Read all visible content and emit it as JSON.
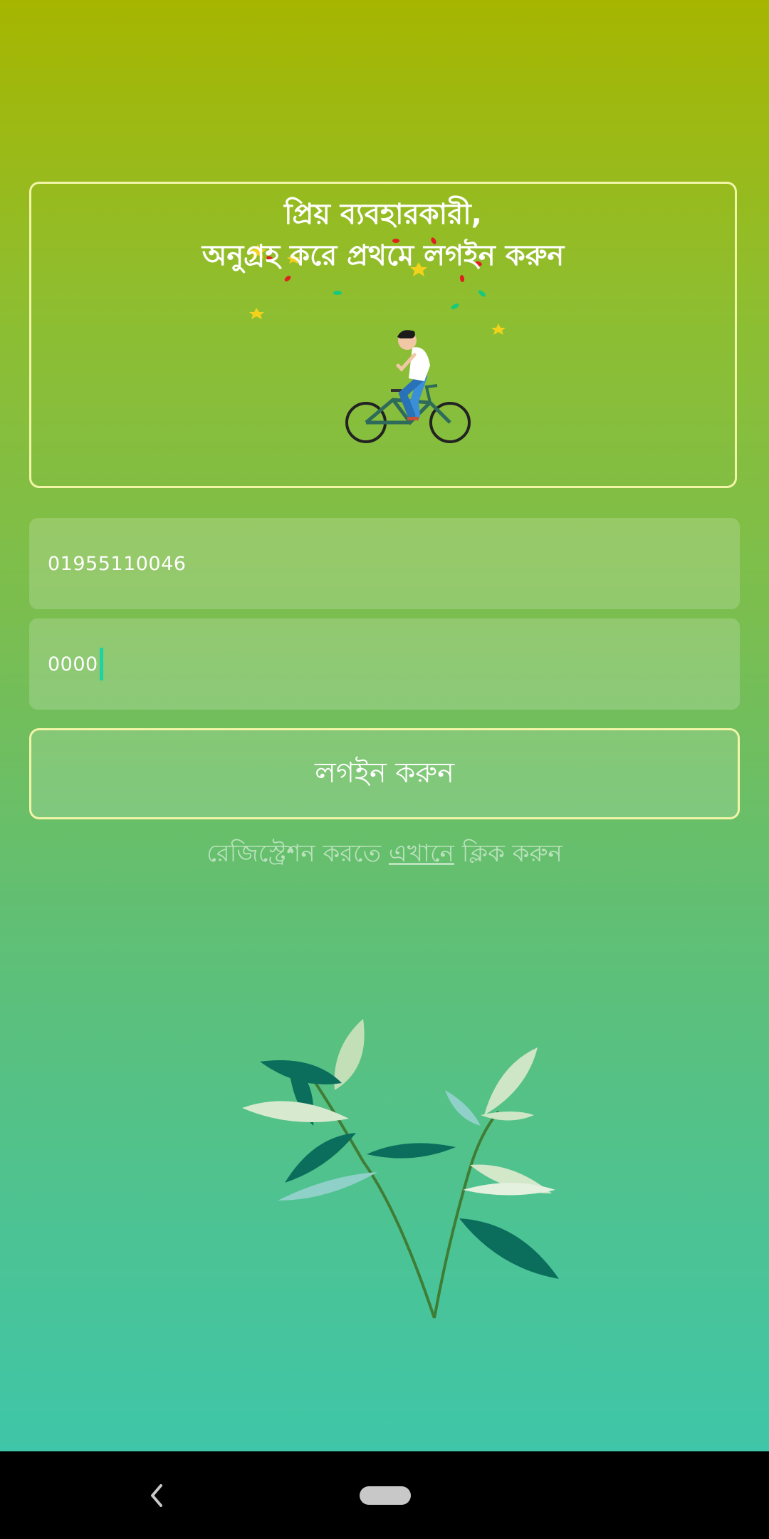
{
  "welcome": {
    "line1": "প্রিয় ব্যবহারকারী,",
    "line2": "অনুগ্রহ করে প্রথমে লগইন করুন"
  },
  "form": {
    "phone_value": "01955110046",
    "password_value": "0000"
  },
  "login_button_label": "লগইন করুন",
  "register": {
    "prefix": "রেজিস্ট্রেশন করতে ",
    "link": "এখানে",
    "suffix": " ক্লিক করুন"
  },
  "colors": {
    "gradient_top": "#a6b600",
    "gradient_bottom": "#3fc6a8",
    "card_border": "#f2f5a8",
    "caret": "#1bd3a4"
  }
}
